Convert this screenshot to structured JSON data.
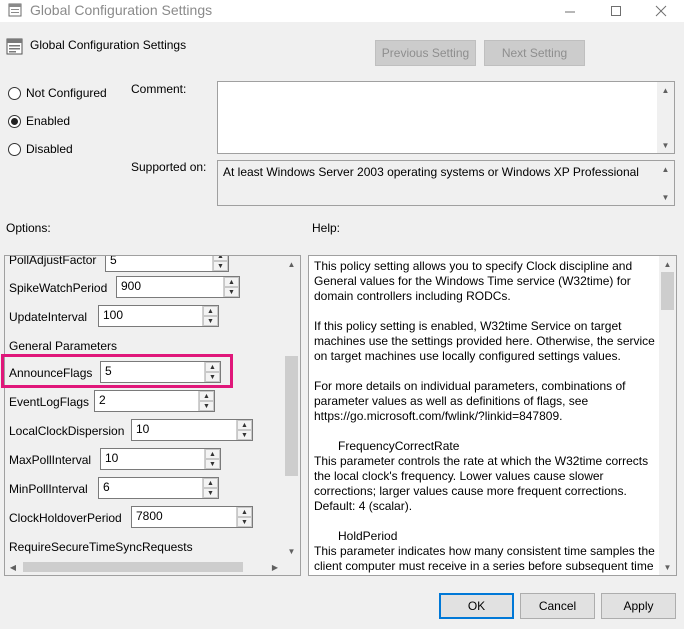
{
  "window": {
    "title": "Global Configuration Settings",
    "minimize_icon": "minimize-icon",
    "maximize_icon": "maximize-icon",
    "close_icon": "close-icon"
  },
  "header": {
    "title": "Global Configuration Settings",
    "previous_label": "Previous Setting",
    "next_label": "Next Setting"
  },
  "state": {
    "not_configured": "Not Configured",
    "enabled": "Enabled",
    "disabled": "Disabled",
    "selected": "Enabled"
  },
  "comment": {
    "label": "Comment:",
    "value": ""
  },
  "supported": {
    "label": "Supported on:",
    "value": "At least Windows Server 2003 operating systems or Windows XP Professional"
  },
  "options": {
    "label": "Options:",
    "items": {
      "poll_adjust_factor": {
        "label": "PollAdjustFactor",
        "value": "5"
      },
      "spike_watch_period": {
        "label": "SpikeWatchPeriod",
        "value": "900"
      },
      "update_interval": {
        "label": "UpdateInterval",
        "value": "100"
      },
      "general_parameters": {
        "label": "General Parameters"
      },
      "announce_flags": {
        "label": "AnnounceFlags",
        "value": "5"
      },
      "event_log_flags": {
        "label": "EventLogFlags",
        "value": "2"
      },
      "local_clock_dispersion": {
        "label": "LocalClockDispersion",
        "value": "10"
      },
      "max_poll_interval": {
        "label": "MaxPollInterval",
        "value": "10"
      },
      "min_poll_interval": {
        "label": "MinPollInterval",
        "value": "6"
      },
      "clock_holdover_period": {
        "label": "ClockHoldoverPeriod",
        "value": "7800"
      },
      "require_secure": {
        "label": "RequireSecureTimeSyncRequests"
      }
    }
  },
  "help": {
    "label": "Help:",
    "p1": "This policy setting allows you to specify Clock discipline and General values for the Windows Time service (W32time) for domain controllers including RODCs.",
    "p2": "If this policy setting is enabled, W32time Service on target machines use the settings provided here. Otherwise, the service on target machines use locally configured settings values.",
    "p3": "For more details on individual parameters, combinations of parameter values as well as definitions of flags, see https://go.microsoft.com/fwlink/?linkid=847809.",
    "p4_title": "FrequencyCorrectRate",
    "p4": "This parameter controls the rate at which the W32time corrects the local clock's frequency. Lower values cause slower corrections; larger values cause more frequent corrections. Default: 4 (scalar).",
    "p5_title": "HoldPeriod",
    "p5": "This parameter indicates how many consistent time samples the client computer must receive in a series before subsequent time"
  },
  "footer": {
    "ok": "OK",
    "cancel": "Cancel",
    "apply": "Apply"
  },
  "colors": {
    "highlight": "#e0177a",
    "accent": "#0078d7"
  }
}
